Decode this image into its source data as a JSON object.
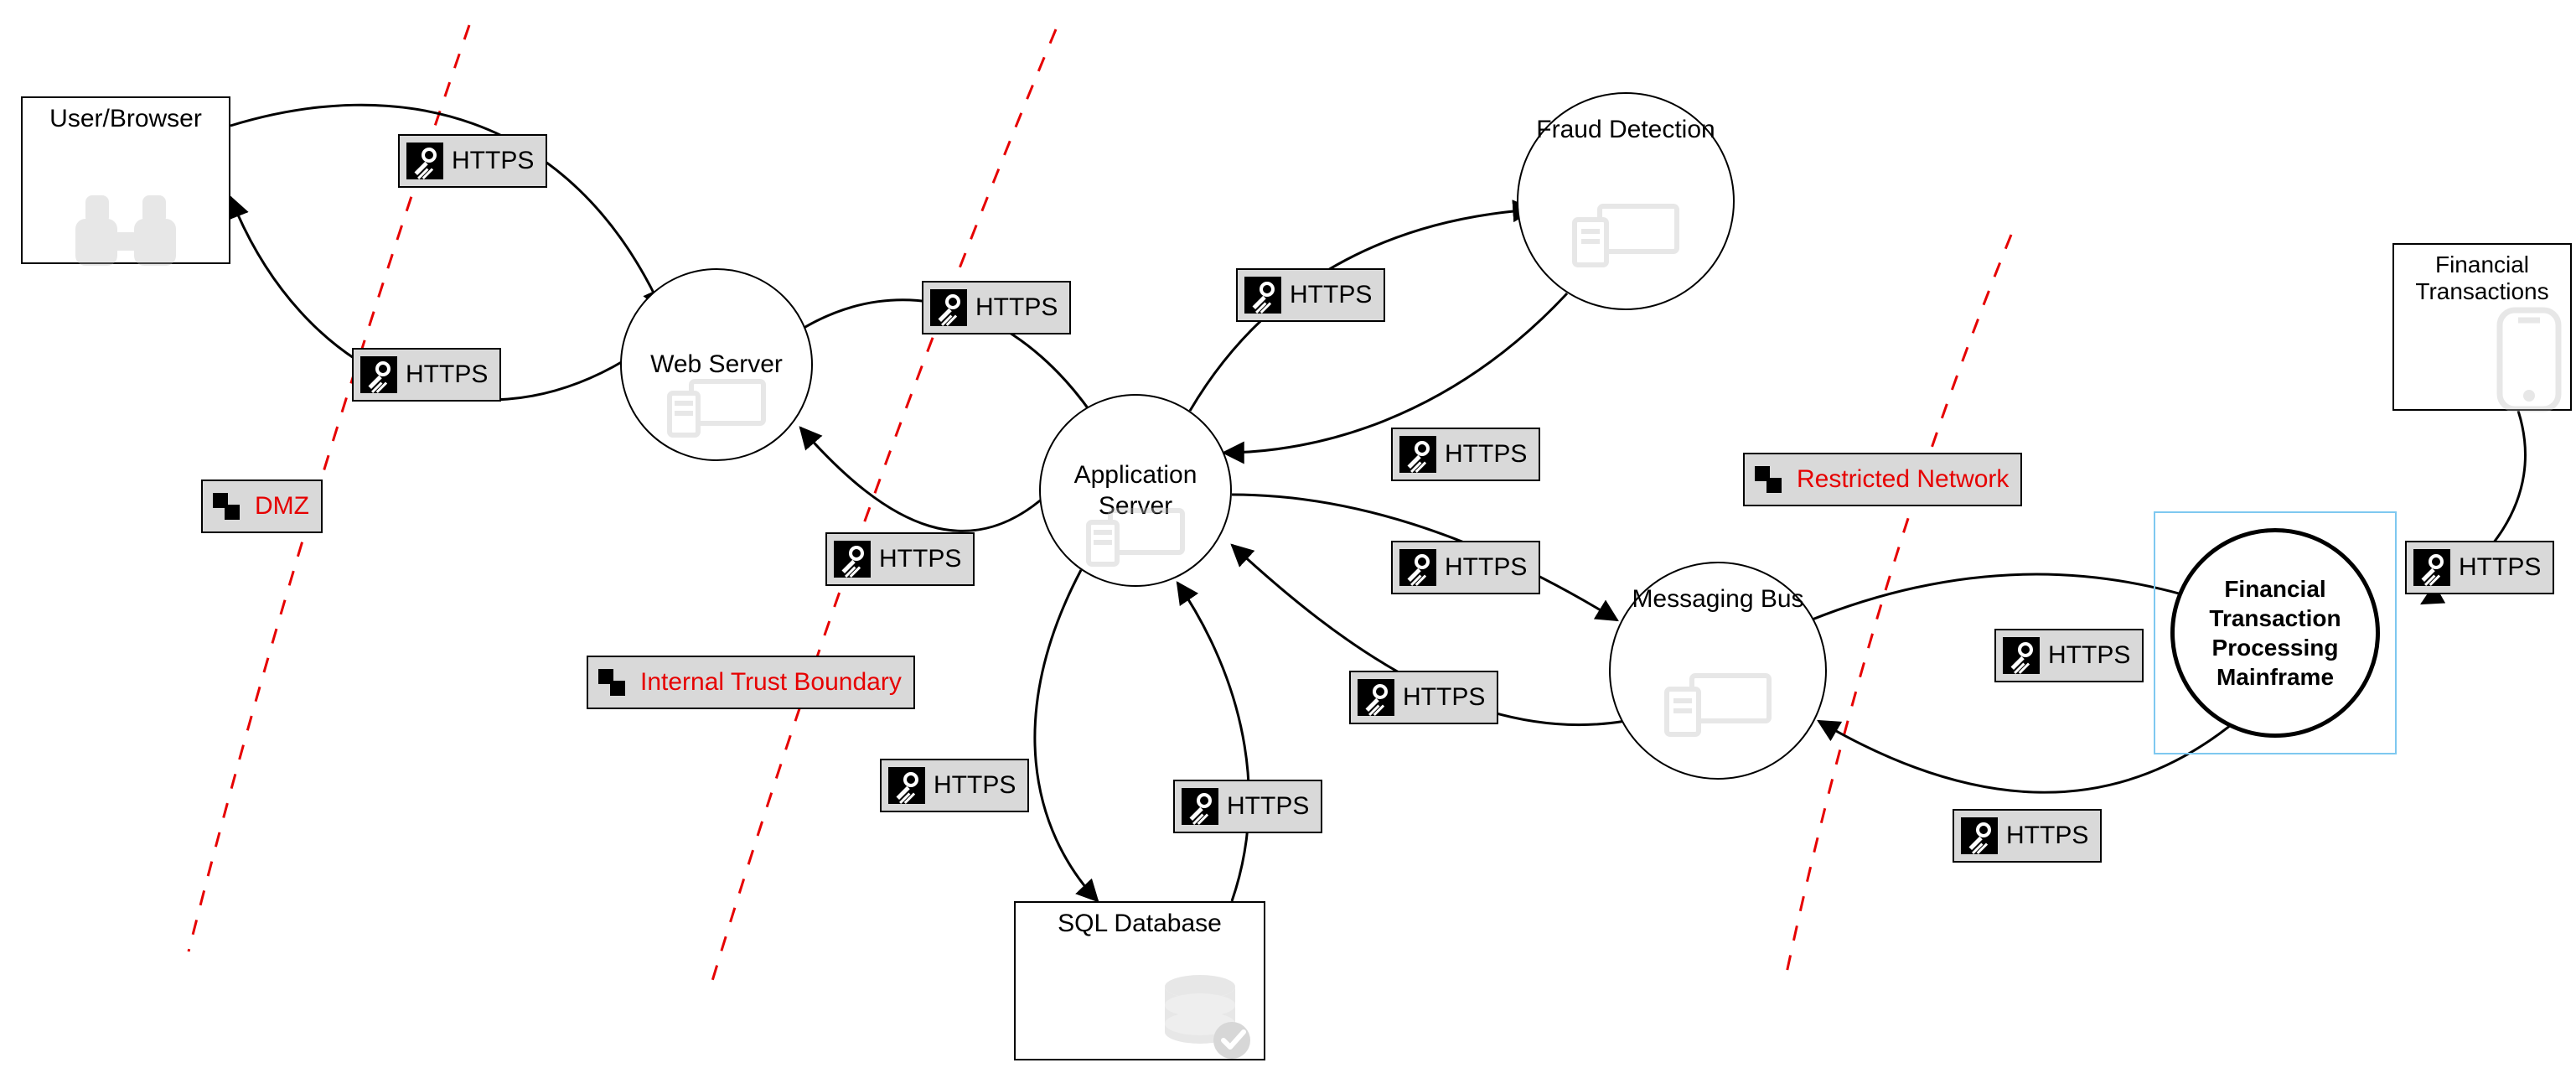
{
  "nodes": {
    "user_browser": {
      "label": "User/Browser"
    },
    "web_server": {
      "label": "Web Server"
    },
    "application_server": {
      "label": "Application\nServer"
    },
    "fraud_detection": {
      "label": "Fraud Detection"
    },
    "sql_database": {
      "label": "SQL Database"
    },
    "messaging_bus": {
      "label": "Messaging Bus"
    },
    "mainframe": {
      "label": "Financial\nTransaction\nProcessing\nMainframe",
      "selected": true
    },
    "financial_tx": {
      "label": "Financial\nTransactions"
    }
  },
  "trust_boundaries": {
    "dmz": {
      "label": "DMZ"
    },
    "internal": {
      "label": "Internal Trust Boundary"
    },
    "restricted": {
      "label": "Restricted Network"
    }
  },
  "protocol_label": "HTTPS",
  "flows": [
    {
      "from": "user_browser",
      "to": "web_server",
      "protocol": "HTTPS"
    },
    {
      "from": "web_server",
      "to": "user_browser",
      "protocol": "HTTPS"
    },
    {
      "from": "web_server",
      "to": "application_server",
      "protocol": "HTTPS"
    },
    {
      "from": "application_server",
      "to": "web_server",
      "protocol": "HTTPS"
    },
    {
      "from": "application_server",
      "to": "fraud_detection",
      "protocol": "HTTPS"
    },
    {
      "from": "fraud_detection",
      "to": "application_server",
      "protocol": "HTTPS"
    },
    {
      "from": "application_server",
      "to": "sql_database",
      "protocol": "HTTPS"
    },
    {
      "from": "sql_database",
      "to": "application_server",
      "protocol": "HTTPS"
    },
    {
      "from": "application_server",
      "to": "messaging_bus",
      "protocol": "HTTPS"
    },
    {
      "from": "messaging_bus",
      "to": "application_server",
      "protocol": "HTTPS"
    },
    {
      "from": "messaging_bus",
      "to": "mainframe",
      "protocol": "HTTPS"
    },
    {
      "from": "mainframe",
      "to": "messaging_bus",
      "protocol": "HTTPS"
    },
    {
      "from": "financial_tx",
      "to": "mainframe",
      "protocol": "HTTPS"
    }
  ]
}
